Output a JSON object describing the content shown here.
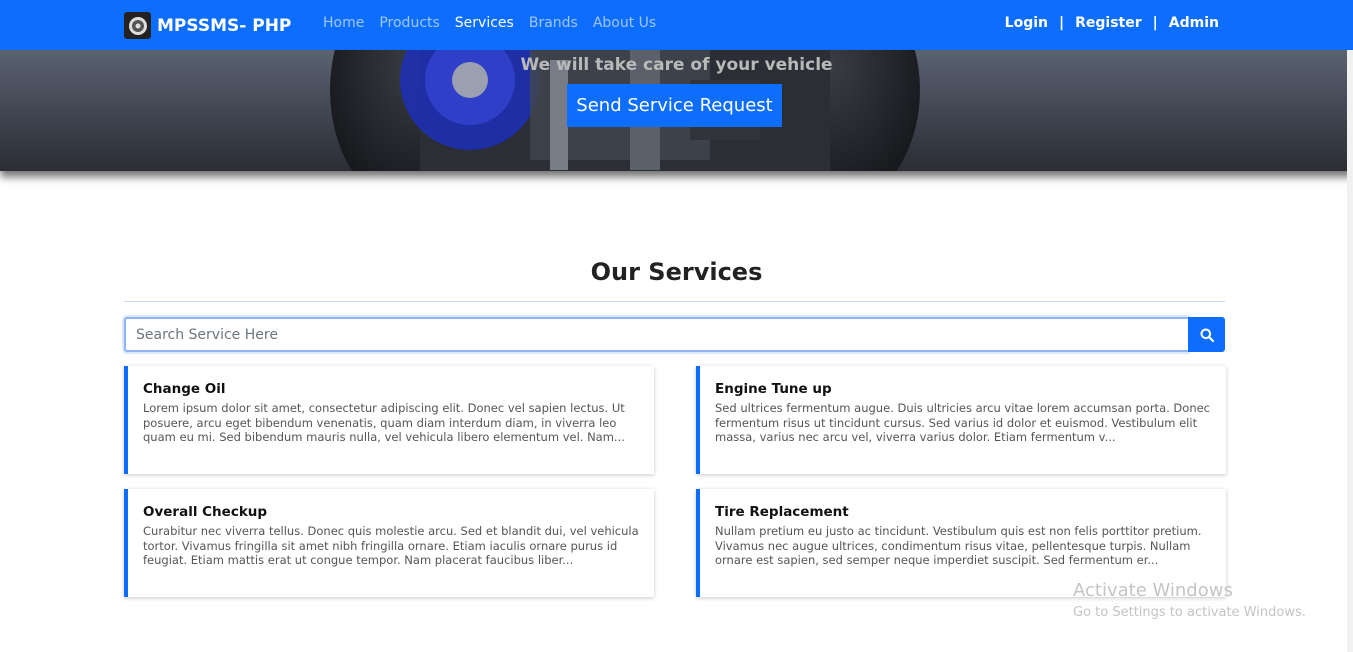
{
  "navbar": {
    "brand": "MPSSMS- PHP",
    "links": [
      {
        "label": "Home"
      },
      {
        "label": "Products"
      },
      {
        "label": "Services"
      },
      {
        "label": "Brands"
      },
      {
        "label": "About Us"
      }
    ],
    "active": "Services",
    "right_links": {
      "login": "Login",
      "register": "Register",
      "admin": "Admin",
      "separator": "|"
    }
  },
  "hero": {
    "subtitle": "We will take care of your vehicle",
    "button_label": "Send Service Request"
  },
  "services": {
    "title": "Our Services",
    "search_placeholder": "Search Service Here",
    "cards": [
      {
        "title": "Change Oil",
        "text": "Lorem ipsum dolor sit amet, consectetur adipiscing elit. Donec vel sapien lectus. Ut posuere, arcu eget bibendum venenatis, quam diam interdum diam, in viverra leo quam eu mi. Sed bibendum mauris nulla, vel vehicula libero elementum vel. Nam..."
      },
      {
        "title": "Engine Tune up",
        "text": "Sed ultrices fermentum augue. Duis ultricies arcu vitae lorem accumsan porta. Donec fermentum risus ut tincidunt cursus. Sed varius id dolor et euismod. Vestibulum elit massa, varius nec arcu vel, viverra varius dolor. Etiam fermentum v..."
      },
      {
        "title": "Overall Checkup",
        "text": "Curabitur nec viverra tellus. Donec quis molestie arcu. Sed et blandit dui, vel vehicula tortor. Vivamus fringilla sit amet nibh fringilla ornare. Etiam iaculis ornare purus id feugiat. Etiam mattis erat ut congue tempor. Nam placerat faucibus liber..."
      },
      {
        "title": "Tire Replacement",
        "text": "Nullam pretium eu justo ac tincidunt. Vestibulum quis est non felis porttitor pretium. Vivamus nec augue ultrices, condimentum risus vitae, pellentesque turpis. Nullam ornare est sapien, sed semper neque imperdiet suscipit. Sed fermentum er..."
      }
    ]
  },
  "watermark": {
    "line1": "Activate Windows",
    "line2": "Go to Settings to activate Windows."
  },
  "colors": {
    "primary": "#0d6efd",
    "white": "#ffffff"
  },
  "icons": {
    "search": "search-icon",
    "logo": "logo-icon"
  }
}
